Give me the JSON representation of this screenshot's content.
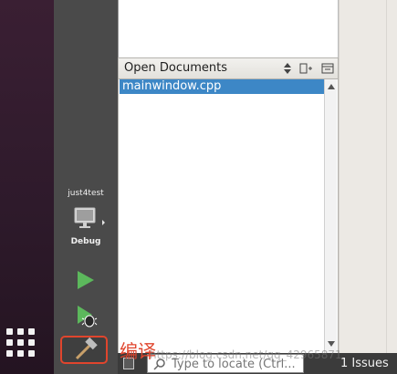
{
  "dock": {
    "apps_icon": "apps-grid-icon"
  },
  "modebar": {
    "project_name": "just4test",
    "build_config": "Debug",
    "target_icon": "monitor-icon",
    "run_icon": "run-icon",
    "debug_icon": "debug-run-icon",
    "build_icon": "hammer-icon"
  },
  "open_documents": {
    "title": "Open Documents",
    "documents": [
      "mainwindow.cpp"
    ]
  },
  "bottom_bar": {
    "locator_placeholder": "Type to locate (Ctrl...",
    "issues_label": "1  Issues"
  },
  "annotation": {
    "text": "编译"
  },
  "watermark": {
    "text": "https://blog.csdn.net/qq_42965871"
  },
  "colors": {
    "selection": "#3d87c6",
    "annotation": "#e0452d",
    "modebar": "#4a4a4a",
    "run_green": "#5cb85c"
  }
}
